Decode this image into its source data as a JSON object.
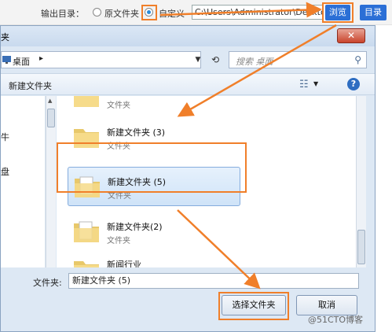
{
  "output_settings": {
    "dir_label": "输出目录：",
    "option_original": "原文件夹",
    "option_custom": "自定义",
    "path_value": "C:\\Users\\Administrator\\Desktop",
    "browse_label": "浏览",
    "dir_button_label": "目录"
  },
  "dialog": {
    "title": "夹",
    "close_glyph": "✕",
    "address": {
      "location": "桌面",
      "chevron": "▸"
    },
    "search_placeholder": "搜索 桌面",
    "toolbar": {
      "new_folder": "新建文件夹",
      "help_glyph": "?"
    },
    "nav_items": [
      {
        "label": "牛"
      },
      {
        "label": "盘"
      }
    ],
    "items": [
      {
        "name": "",
        "type": "文件夹"
      },
      {
        "name": "新建文件夹 (3)",
        "type": "文件夹"
      },
      {
        "name": "新建文件夹 (5)",
        "type": "文件夹",
        "selected": true
      },
      {
        "name": "新建文件夹(2)",
        "type": "文件夹"
      },
      {
        "name": "新闻行业",
        "type": "文件夹"
      }
    ],
    "filename_label": "文件夹:",
    "filename_value": "新建文件夹 (5)",
    "select_button": "选择文件夹",
    "cancel_button": "取消"
  },
  "watermark": "@51CTO博客",
  "colors": {
    "accent_orange": "#f07f2a",
    "button_blue": "#2b6fd6",
    "selection": "#cfe3f8"
  }
}
